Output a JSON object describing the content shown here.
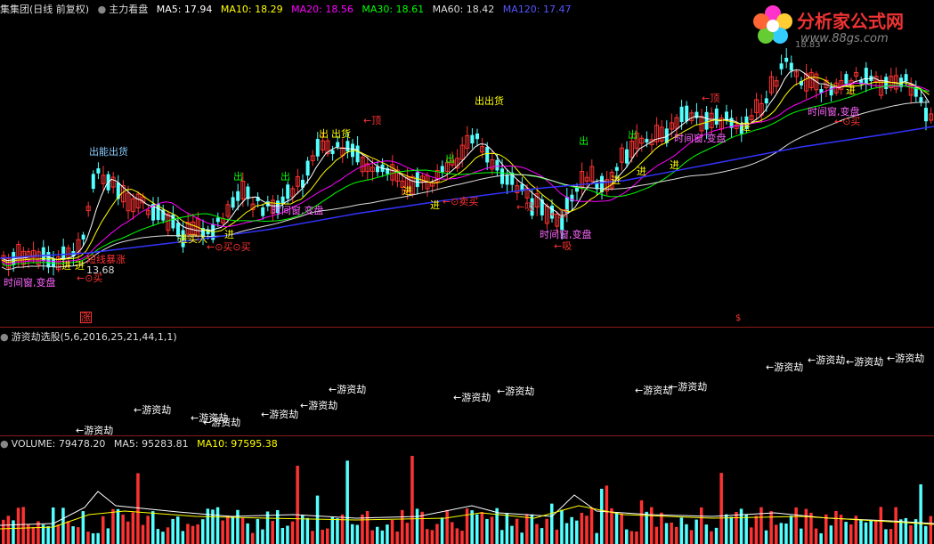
{
  "price_header": {
    "title": "集集团(日线 前复权)",
    "indicator": "主力看盘",
    "ma5": "MA5: 17.94",
    "ma10": "MA10: 18.29",
    "ma20": "MA20: 18.56",
    "ma30": "MA30: 18.61",
    "ma60": "MA60: 18.42",
    "ma120": "MA120: 17.47"
  },
  "indicator_header": {
    "title": "游资劫选股(5,6,2016,25,21,44,1,1)"
  },
  "volume_header": {
    "volume": "VOLUME: 79478.20",
    "ma5": "MA5: 95283.81",
    "ma10": "MA10: 97595.38"
  },
  "logo": {
    "text": "分析家公式网",
    "url": "www.88gs.com"
  },
  "colors": {
    "up": "#ff3232",
    "down": "#54ffff",
    "ma5": "#ffffff",
    "ma10": "#ffff00",
    "ma20": "#ff00ff",
    "ma30": "#00ff00",
    "ma60": "#dddddd",
    "ma120": "#3333ff"
  },
  "price_labels": {
    "l1": "出能出货",
    "l2": "出",
    "l3": "出",
    "l4": "出",
    "l5": "←顶",
    "l6": "出货",
    "l7": "出出货",
    "l8": "←顶",
    "l9": "出",
    "l10": "出",
    "l11": "出",
    "l12": "←顶",
    "l13": "进",
    "l14": "进",
    "l15": "进",
    "l16": "进",
    "l17": "进",
    "l18": "进",
    "l19": "进",
    "l20": "进",
    "l21": "进",
    "l22": "进",
    "l23": "←⊙买",
    "l24": "←⊙买⊙买",
    "l25": "←⊙卖买",
    "l26": "←⊙买",
    "l27": "时间窗,变盘",
    "l28": "时间窗,变盘",
    "l29": "时间窗,变盘",
    "l30": "时间窗,变盘",
    "l31": "时间窗,变盘",
    "l32": "短线暴涨",
    "l33": "13.68",
    "l34": "←吸",
    "l35": "←吸",
    "l36": "涨",
    "l37": "$",
    "l38": "进买入",
    "l39": "18.83"
  },
  "indicator_labels": {
    "a1": "←游资劫",
    "a2": "←游资劫",
    "a3": "←游资劫",
    "a4": "←游资劫",
    "a5": "←游资劫",
    "a6": "←游资劫",
    "a7": "←游资劫",
    "a8": "←游资劫",
    "a9": "←游资劫",
    "a10": "←游资劫",
    "a11": "←游资劫",
    "a12": "←游资劫",
    "a13": "←游资劫",
    "a14": "←游资劫",
    "a15": "←游资劫"
  }
}
